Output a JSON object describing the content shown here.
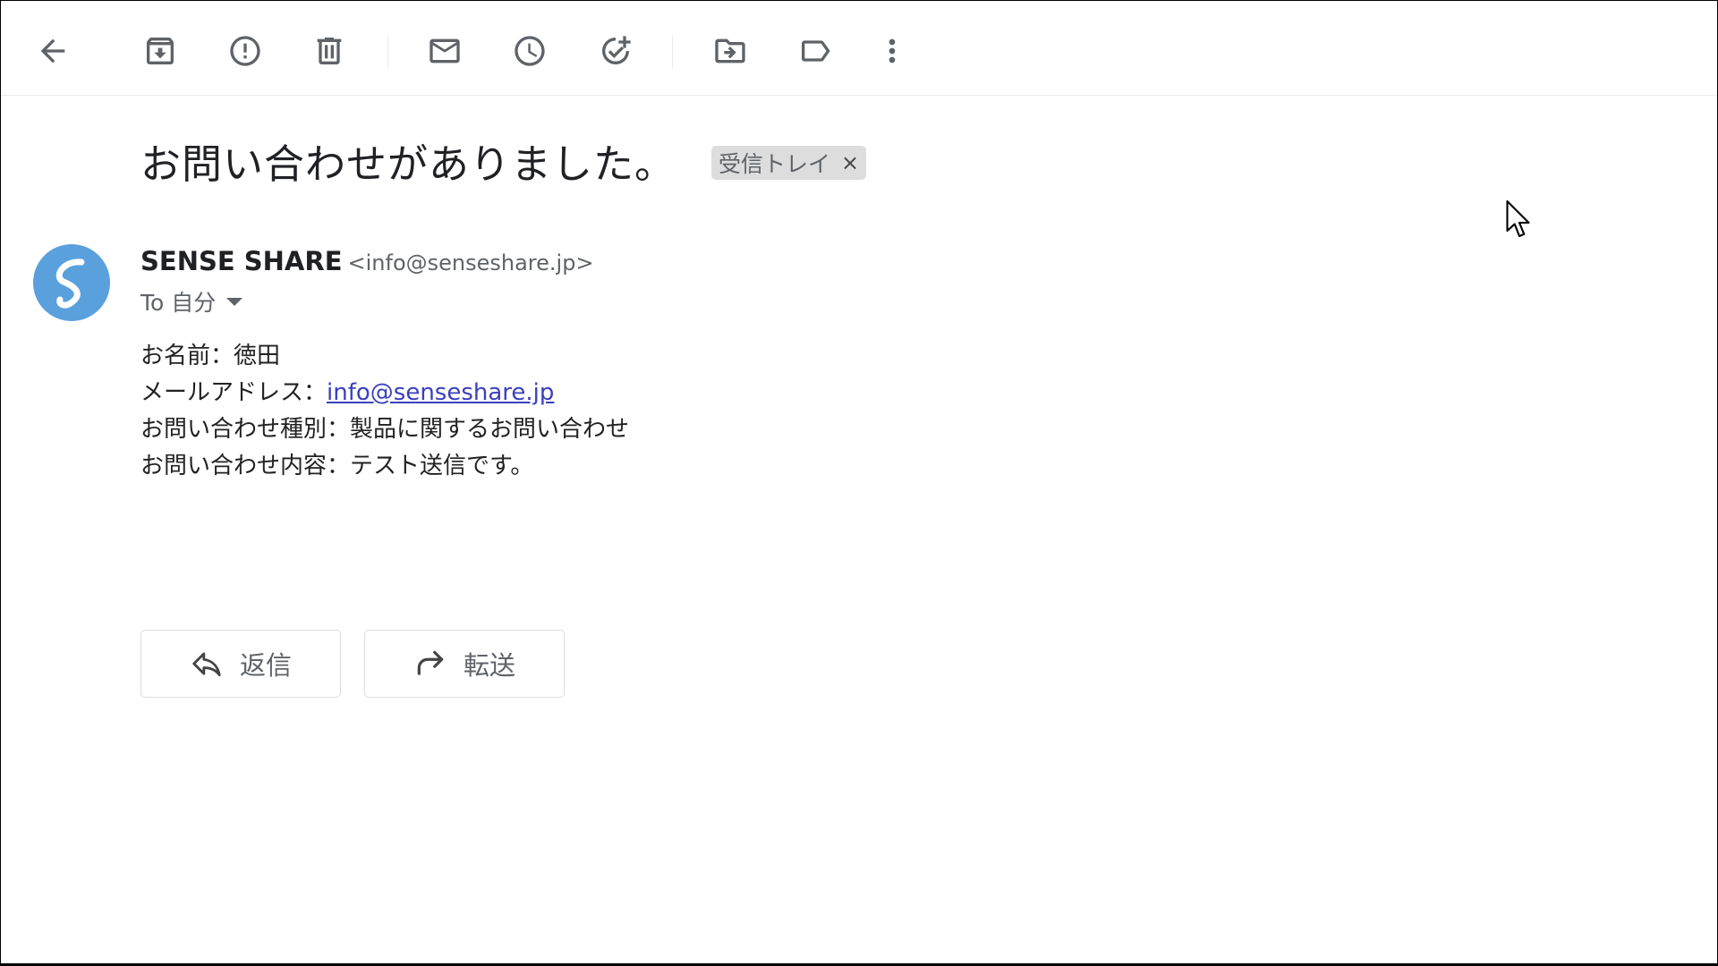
{
  "toolbar": {
    "buttons": [
      {
        "name": "back-button",
        "icon": "arrow-left-icon"
      },
      {
        "name": "archive-button",
        "icon": "archive-icon"
      },
      {
        "name": "report-spam-button",
        "icon": "report-spam-icon"
      },
      {
        "name": "delete-button",
        "icon": "trash-icon"
      },
      {
        "name": "mark-unread-button",
        "icon": "mail-icon"
      },
      {
        "name": "snooze-button",
        "icon": "clock-icon"
      },
      {
        "name": "add-to-tasks-button",
        "icon": "add-task-icon"
      },
      {
        "name": "move-to-button",
        "icon": "move-folder-icon"
      },
      {
        "name": "labels-button",
        "icon": "label-icon"
      },
      {
        "name": "more-button",
        "icon": "more-vert-icon"
      }
    ]
  },
  "email": {
    "subject": "お問い合わせがありました。",
    "label": "受信トレイ",
    "label_remove": "×",
    "sender_name": "SENSE SHARE",
    "sender_email": "<info@senseshare.jp>",
    "to": "To 自分",
    "body": {
      "name_line": "お名前：徳田",
      "email_prefix": "メールアドレス：",
      "email_link": "info@senseshare.jp",
      "type_line": "お問い合わせ種別：製品に関するお問い合わせ",
      "content_line": "お問い合わせ内容：テスト送信です。"
    }
  },
  "actions": {
    "reply": "返信",
    "forward": "転送"
  },
  "colors": {
    "avatar": "#5aa0dc",
    "link": "#3b3fbf",
    "icon": "#5f6368",
    "chip": "#dddddd"
  }
}
